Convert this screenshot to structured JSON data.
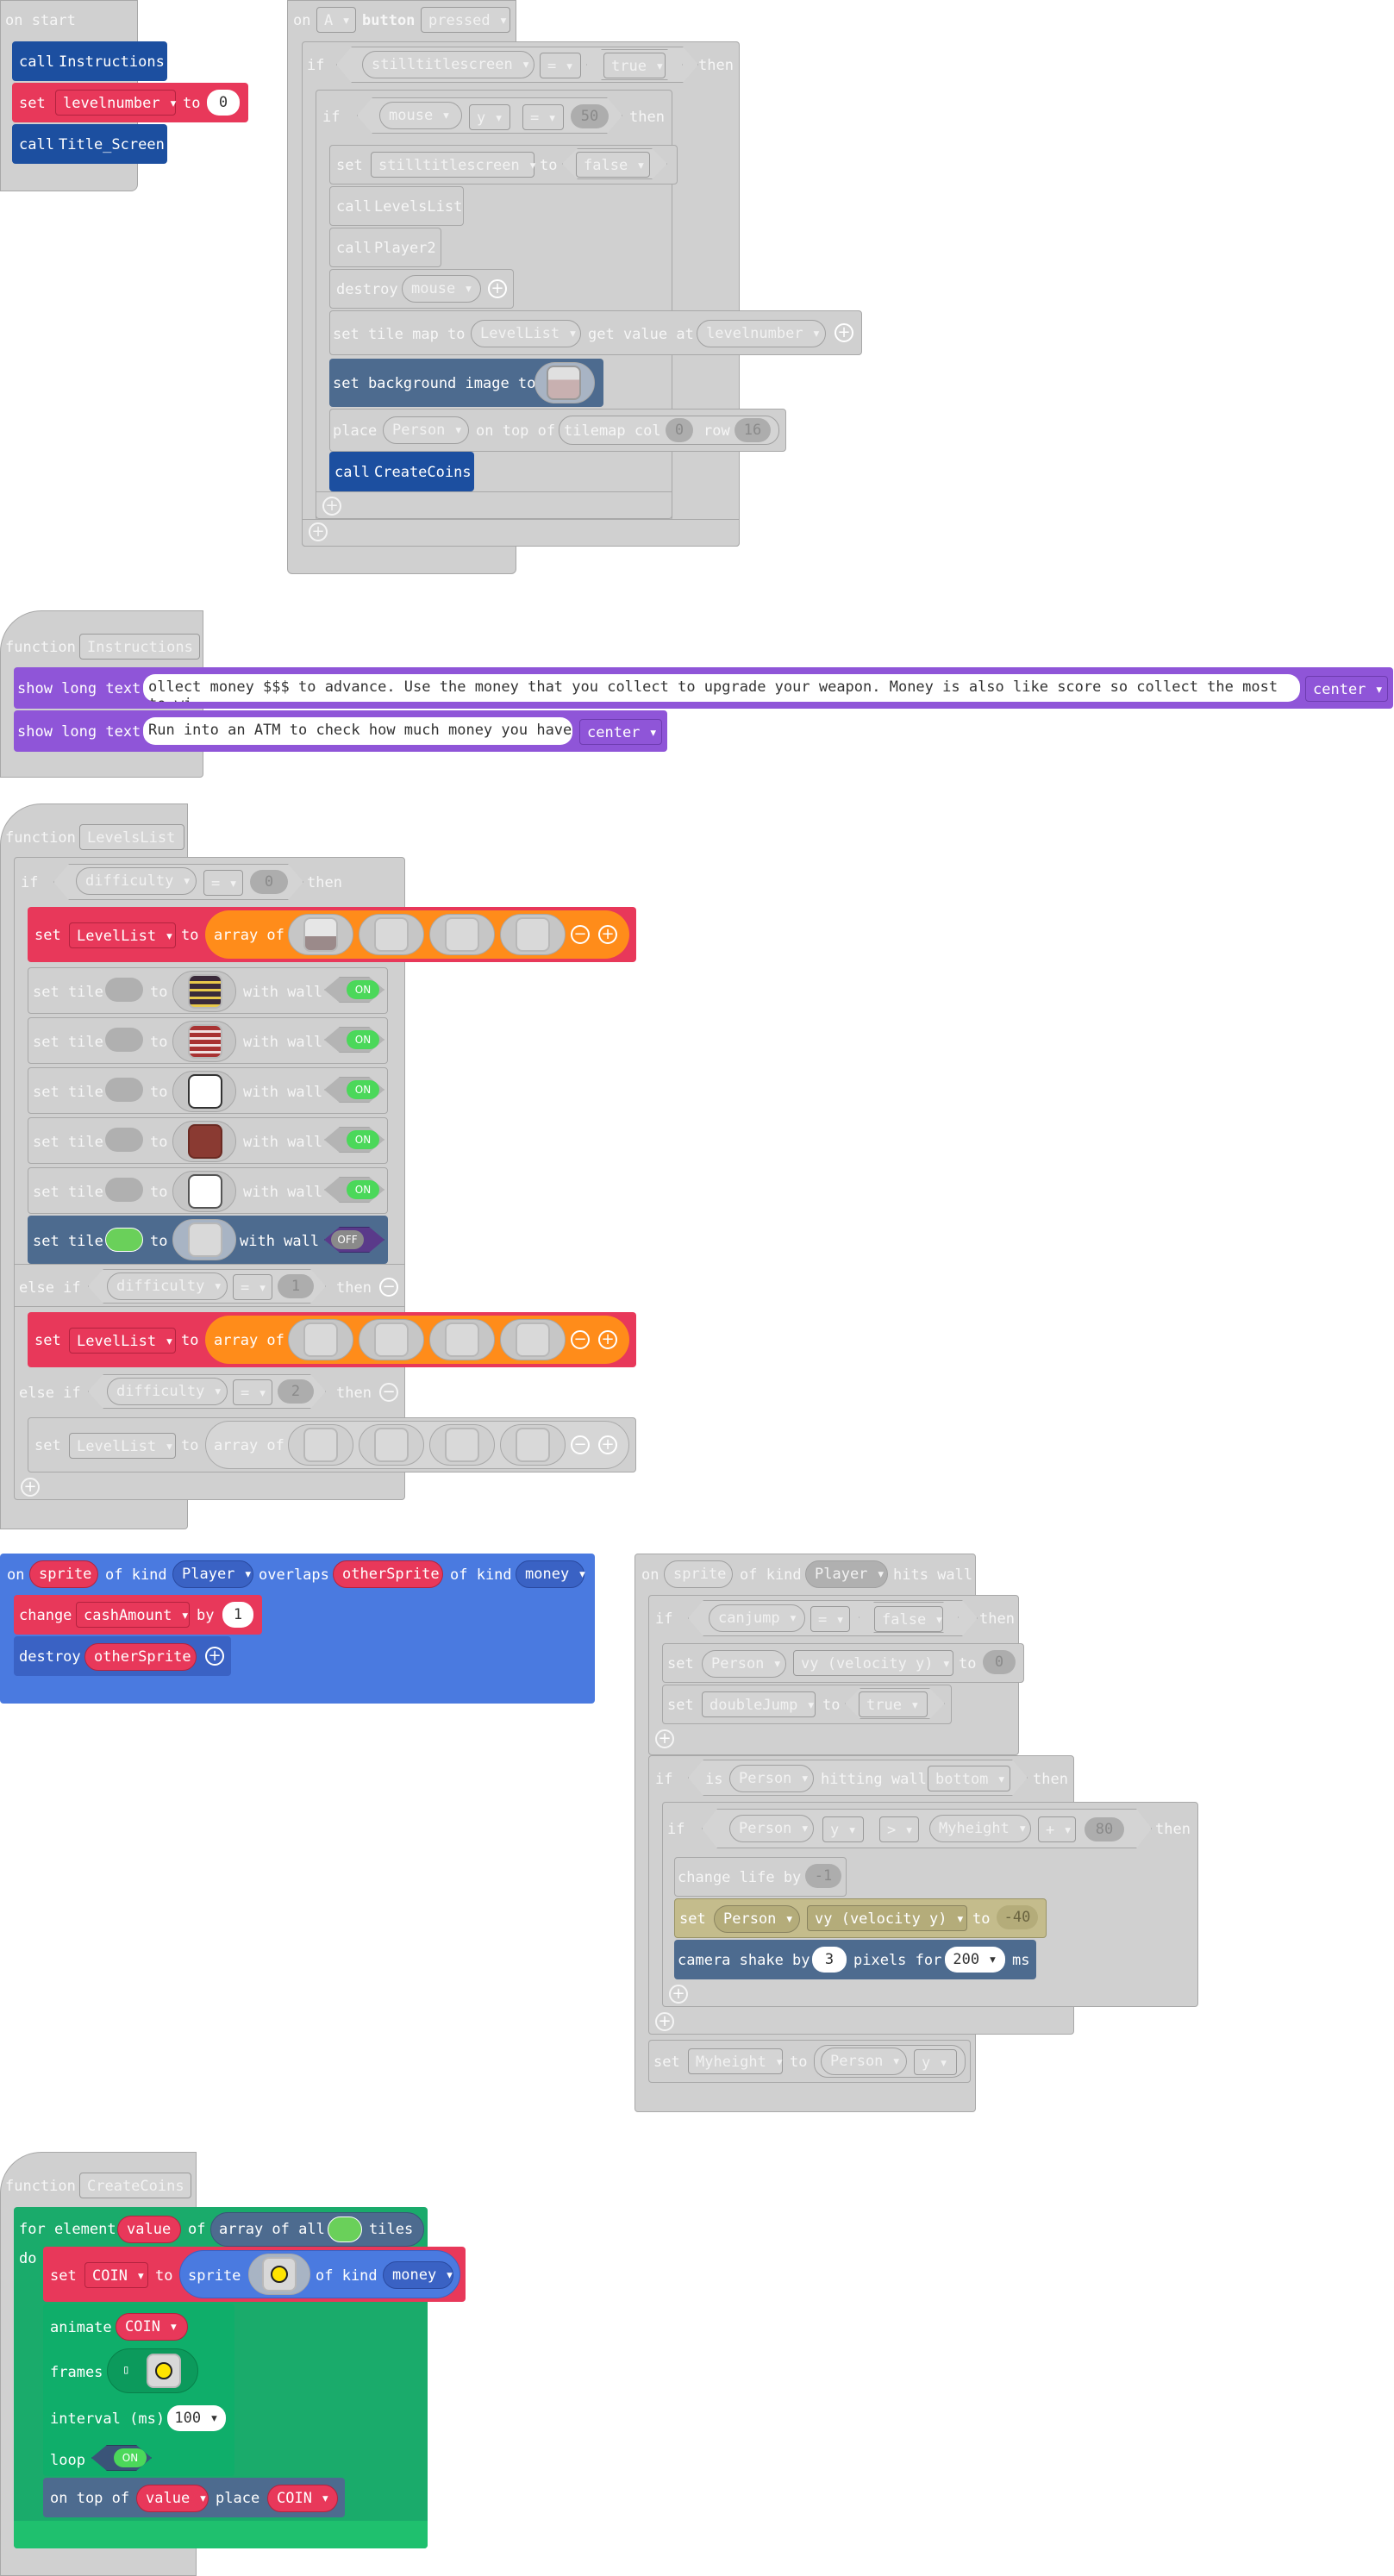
{
  "on_start": {
    "hat": "on start",
    "call1_kw": "call",
    "call1_name": "Instructions",
    "set_kw": "set",
    "set_var": "levelnumber",
    "to": "to",
    "set_val": "0",
    "call2_kw": "call",
    "call2_name": "Title_Screen"
  },
  "on_button": {
    "on": "on",
    "button_key": "A",
    "button_kw": "button",
    "event": "pressed",
    "if1_kw": "if",
    "if1_var": "stilltitlescreen",
    "if1_op": "=",
    "if1_val": "true",
    "then": "then",
    "if2_kw": "if",
    "if2_obj": "mouse",
    "if2_prop": "y",
    "if2_op": "=",
    "if2_val": "50",
    "set_kw": "set",
    "set_var": "stilltitlescreen",
    "set_to": "to",
    "set_val": "false",
    "call_kw": "call",
    "call_levels": "LevelsList",
    "call_player": "Player2",
    "destroy_kw": "destroy",
    "destroy_obj": "mouse",
    "tilemap_kw": "set tile map to",
    "tilemap_list": "LevelList",
    "get_value_at": "get value at",
    "tilemap_idx": "levelnumber",
    "bg_kw": "set background image to",
    "place_kw": "place",
    "place_obj": "Person",
    "on_top_of": "on top of",
    "tilemap_col": "tilemap col",
    "col_val": "0",
    "row_kw": "row",
    "row_val": "16",
    "call_coins": "CreateCoins"
  },
  "instructions_fn": {
    "function_kw": "function",
    "name": "Instructions",
    "show1_kw": "show long text",
    "show1_text": "ollect money $$$ to advance. Use the money that you collect to upgrade your weapon. Money is also like score so collect the most to wi",
    "show1_pos": "center",
    "show2_kw": "show long text",
    "show2_text": "Run into an ATM to check how much money you have",
    "show2_pos": "center"
  },
  "levels_fn": {
    "function_kw": "function",
    "name": "LevelsList",
    "if_kw": "if",
    "if_var": "difficulty",
    "if_op": "=",
    "if_val": "0",
    "then": "then",
    "set_kw": "set",
    "list_var": "LevelList",
    "to": "to",
    "array_of": "array of",
    "set_tile_kw": "set tile",
    "with_wall": "with wall",
    "on": "ON",
    "off": "OFF",
    "elseif_kw": "else if",
    "elseif1_var": "difficulty",
    "elseif1_op": "=",
    "elseif1_val": "1",
    "elseif2_var": "difficulty",
    "elseif2_op": "=",
    "elseif2_val": "2"
  },
  "overlap_event": {
    "on": "on",
    "sprite": "sprite",
    "of_kind": "of kind",
    "kind1": "Player",
    "overlaps": "overlaps",
    "other": "otherSprite",
    "kind2": "money",
    "change_kw": "change",
    "change_var": "cashAmount",
    "by": "by",
    "change_val": "1",
    "destroy_kw": "destroy",
    "destroy_obj": "otherSprite"
  },
  "hits_wall": {
    "on": "on",
    "sprite": "sprite",
    "of_kind": "of kind",
    "kind": "Player",
    "hits_wall": "hits wall",
    "if1_kw": "if",
    "if1_var": "canjump",
    "if1_op": "=",
    "if1_val": "false",
    "then": "then",
    "set_kw": "set",
    "set_obj": "Person",
    "set_prop": "vy (velocity y)",
    "to": "to",
    "set_val": "0",
    "set2_var": "doubleJump",
    "set2_val": "true",
    "if2_kw": "if",
    "is_kw": "is",
    "is_obj": "Person",
    "hitting_wall": "hitting wall",
    "wall_side": "bottom",
    "if3_kw": "if",
    "if3_obj": "Person",
    "if3_prop": "y",
    "if3_op": ">",
    "if3_var": "Myheight",
    "if3_arith": "+",
    "if3_num": "80",
    "life_kw": "change life by",
    "life_val": "-1",
    "set3_obj": "Person",
    "set3_prop": "vy (velocity y)",
    "set3_val": "-40",
    "shake_kw": "camera shake by",
    "shake_val": "3",
    "pixels_for": "pixels for",
    "shake_ms": "200",
    "ms": "ms",
    "set4_var": "Myheight",
    "set4_obj": "Person",
    "set4_prop": "y"
  },
  "coins_fn": {
    "function_kw": "function",
    "name": "CreateCoins",
    "for_kw": "for element",
    "for_var": "value",
    "of_kw": "of",
    "array_all": "array of all",
    "tiles_kw": "tiles",
    "do_kw": "do",
    "set_kw": "set",
    "set_var": "COIN",
    "to": "to",
    "sprite_kw": "sprite",
    "of_kind": "of kind",
    "kind": "money",
    "animate_kw": "animate",
    "animate_var": "COIN",
    "frames_kw": "frames",
    "interval_kw": "interval (ms)",
    "interval_val": "100",
    "loop_kw": "loop",
    "loop_val": "ON",
    "ontop_kw": "on top of",
    "ontop_var": "value",
    "place_kw": "place",
    "place_var": "COIN"
  }
}
